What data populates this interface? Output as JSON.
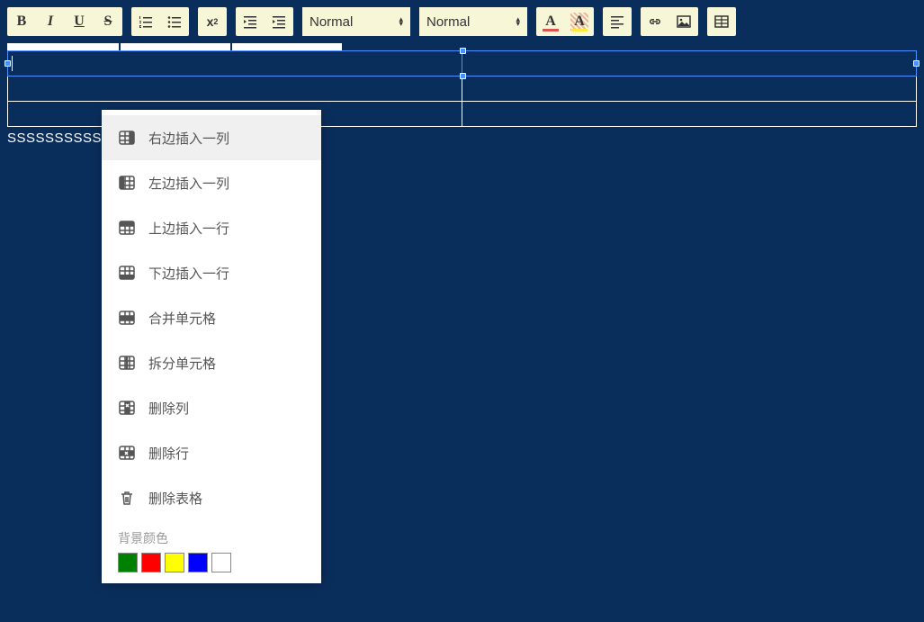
{
  "toolbar": {
    "bold": "B",
    "italic": "I",
    "underline": "U",
    "strike": "S",
    "superscript_base": "x",
    "superscript_exp": "2",
    "heading_select": "Normal",
    "size_select": "Normal",
    "text_color_letter": "A",
    "text_color_value": "#d9534f",
    "highlight_color_letter": "A",
    "highlight_color_value": "#ffeb3b"
  },
  "ruler_segments": [
    124,
    122,
    122
  ],
  "editor": {
    "table_rows": 3,
    "table_cols": 2,
    "selected_row_index": 0,
    "body_text": "SSSSSSSSSSSSSSSSSSSS"
  },
  "context_menu": {
    "items": [
      {
        "key": "insert-col-right",
        "label": "右边插入一列",
        "icon": "table-col-right",
        "hovered": true
      },
      {
        "key": "insert-col-left",
        "label": "左边插入一列",
        "icon": "table-col-left"
      },
      {
        "key": "insert-row-above",
        "label": "上边插入一行",
        "icon": "table-row-above"
      },
      {
        "key": "insert-row-below",
        "label": "下边插入一行",
        "icon": "table-row-below"
      },
      {
        "key": "merge-cells",
        "label": "合并单元格",
        "icon": "table-merge"
      },
      {
        "key": "split-cells",
        "label": "拆分单元格",
        "icon": "table-split"
      },
      {
        "key": "delete-col",
        "label": "删除列",
        "icon": "table-del-col"
      },
      {
        "key": "delete-row",
        "label": "删除行",
        "icon": "table-del-row"
      },
      {
        "key": "delete-table",
        "label": "删除表格",
        "icon": "trash"
      }
    ],
    "bg_color_label": "背景颜色",
    "colors": [
      "#008000",
      "#ff0000",
      "#ffff00",
      "#0000ff",
      "#ffffff"
    ]
  }
}
